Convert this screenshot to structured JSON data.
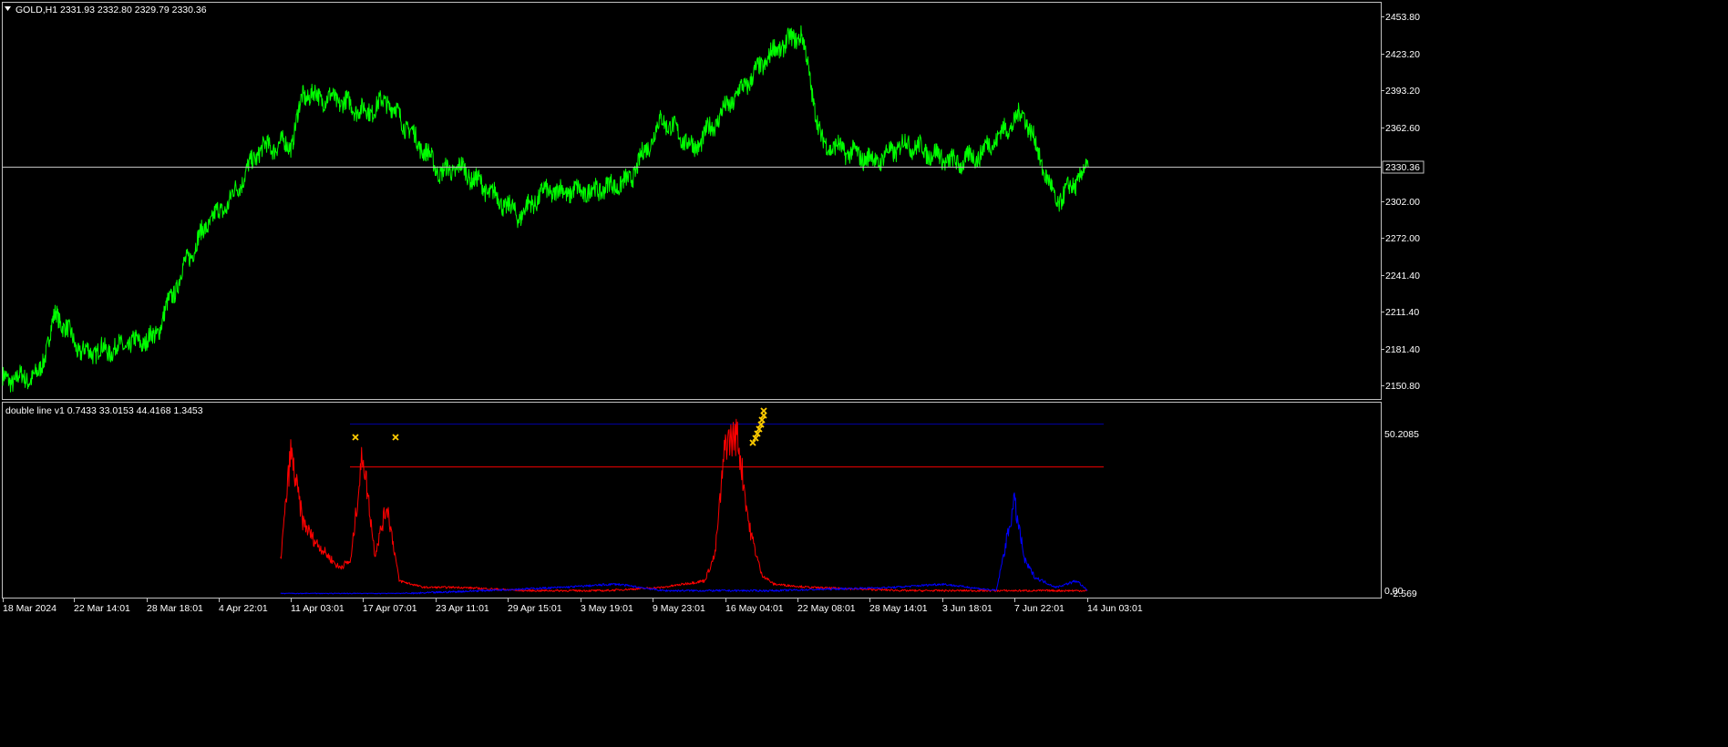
{
  "header": {
    "symbol_label": "GOLD,H1",
    "ohlc": "2331.93 2332.80 2329.79 2330.36",
    "collapse_icon": "triangle-down-icon"
  },
  "indicator": {
    "label": "double line v1 0.7433 33.0153 44.4168 1.3453",
    "scale_top": "50.2085",
    "scale_bottom_a": "0.00",
    "scale_bottom_b": "-2.569"
  },
  "price_axis": {
    "labels": [
      "2453.80",
      "2423.20",
      "2393.20",
      "2362.60",
      "2302.00",
      "2272.00",
      "2241.40",
      "2211.40",
      "2181.40",
      "2150.80"
    ],
    "current_price": "2330.36"
  },
  "time_axis": {
    "labels": [
      "18 Mar 2024",
      "22 Mar 14:01",
      "28 Mar 18:01",
      "4 Apr 22:01",
      "11 Apr 03:01",
      "17 Apr 07:01",
      "23 Apr 11:01",
      "29 Apr 15:01",
      "3 May 19:01",
      "9 May 23:01",
      "16 May 04:01",
      "22 May 08:01",
      "28 May 14:01",
      "3 Jun 18:01",
      "7 Jun 22:01",
      "14 Jun 03:01"
    ]
  },
  "colors": {
    "background": "#000000",
    "price_line": "#00ff00",
    "frame": "#c0c0c0",
    "current_price_line": "#c0c0c0",
    "indicator_red": "#ff0000",
    "indicator_blue": "#0000ff",
    "marker": "#ffcc00",
    "level_top": "#00008b",
    "level_mid": "#cc0000"
  },
  "chart_data": [
    {
      "type": "line",
      "title": "GOLD,H1",
      "series": [
        {
          "name": "GOLD,H1",
          "x": [
            "18 Mar 2024",
            "20 Mar",
            "21 Mar",
            "22 Mar 14:01",
            "25 Mar",
            "28 Mar 18:01",
            "1 Apr",
            "3 Apr",
            "4 Apr 22:01",
            "8 Apr",
            "11 Apr 03:01",
            "12 Apr",
            "15 Apr",
            "17 Apr 07:01",
            "19 Apr",
            "23 Apr 11:01",
            "25 Apr",
            "29 Apr 15:01",
            "1 May",
            "3 May 19:01",
            "7 May",
            "9 May 23:01",
            "13 May",
            "16 May 04:01",
            "20 May",
            "22 May 08:01",
            "24 May",
            "28 May 14:01",
            "31 May",
            "3 Jun 18:01",
            "5 Jun",
            "7 Jun 22:01",
            "11 Jun",
            "14 Jun 03:01"
          ],
          "values": [
            2155,
            2158,
            2210,
            2178,
            2180,
            2190,
            2255,
            2285,
            2300,
            2345,
            2350,
            2390,
            2385,
            2375,
            2385,
            2325,
            2330,
            2290,
            2310,
            2310,
            2318,
            2370,
            2345,
            2380,
            2425,
            2440,
            2350,
            2335,
            2350,
            2333,
            2340,
            2375,
            2300,
            2330
          ]
        }
      ],
      "ylim": [
        2140,
        2465
      ],
      "grid": false
    },
    {
      "type": "line",
      "title": "double line v1",
      "series": [
        {
          "name": "red",
          "x": [
            "10 Apr",
            "11 Apr",
            "12 Apr",
            "13 Apr",
            "15 Apr",
            "16 Apr",
            "17 Apr",
            "18 Apr",
            "19 Apr",
            "20 Apr",
            "22 Apr",
            "25 Apr",
            "30 Apr",
            "5 May",
            "10 May",
            "14 May",
            "15 May",
            "16 May",
            "17 May",
            "18 May",
            "19 May",
            "20 May",
            "23 May",
            "31 May",
            "7 Jun",
            "10 Jun",
            "14 Jun"
          ],
          "values": [
            10,
            43,
            22,
            16,
            8,
            10,
            43,
            12,
            27,
            4,
            2,
            2,
            1,
            1,
            2,
            4,
            12,
            46,
            48,
            20,
            6,
            3,
            2,
            1,
            1,
            1,
            1
          ]
        },
        {
          "name": "blue",
          "x": [
            "10 Apr",
            "20 Apr",
            "2 May",
            "6 May",
            "10 May",
            "20 May",
            "30 May",
            "3 Jun",
            "6 Jun",
            "7 Jun",
            "8 Jun",
            "9 Jun",
            "11 Jun",
            "13 Jun",
            "14 Jun"
          ],
          "values": [
            0,
            0,
            2,
            3,
            1,
            1,
            2,
            3,
            1,
            28,
            10,
            5,
            2,
            4,
            1
          ]
        }
      ],
      "levels": [
        48,
        33
      ],
      "ylim": [
        -2.569,
        50.2085
      ],
      "grid": false
    }
  ]
}
